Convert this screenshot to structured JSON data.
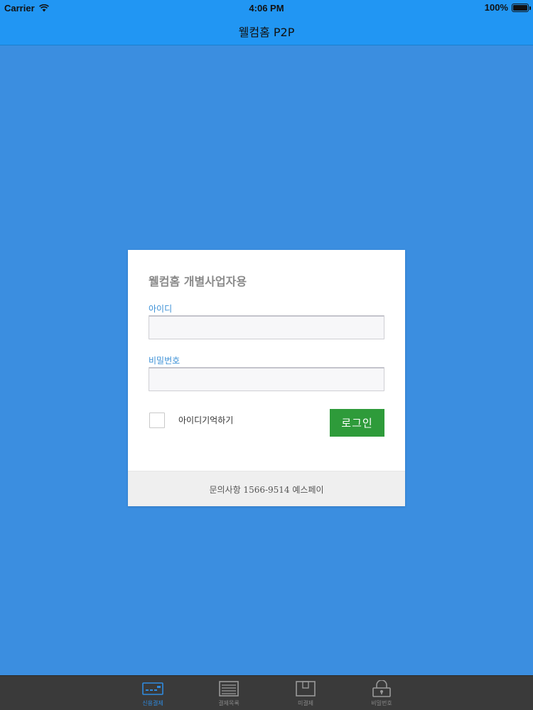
{
  "status": {
    "carrier": "Carrier",
    "time": "4:06 PM",
    "battery": "100%"
  },
  "nav": {
    "title": "웰컴홈 P2P"
  },
  "login": {
    "title": "웰컴홈 개별사업자용",
    "id_label": "아이디",
    "id_value": "",
    "password_label": "비밀번호",
    "password_value": "",
    "remember_label": "아이디기억하기",
    "remember_checked": false,
    "login_button": "로그인",
    "footer": "문의사항 1566-9514 예스페이"
  },
  "tabs": [
    {
      "label": "신용결제",
      "icon": "card-reader-icon",
      "active": true
    },
    {
      "label": "결제목록",
      "icon": "receipt-list-icon",
      "active": false
    },
    {
      "label": "미결제",
      "icon": "pending-box-icon",
      "active": false
    },
    {
      "label": "비밀번호",
      "icon": "lock-icon",
      "active": false
    }
  ],
  "colors": {
    "background": "#3b8ee0",
    "bar": "#2196f3",
    "accent": "#3a8fd6",
    "login_button": "#2e9b3a",
    "tab_bar": "#3a3a3a"
  }
}
